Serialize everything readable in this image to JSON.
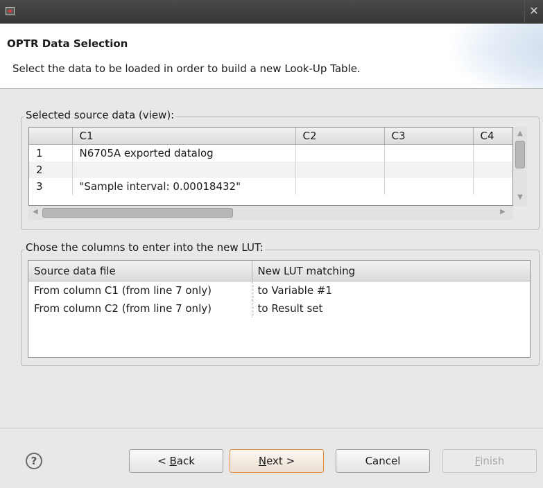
{
  "window": {
    "close_glyph": "✕"
  },
  "header": {
    "title": "OPTR Data Selection",
    "description": "Select the data to be loaded in order to build a new Look-Up Table."
  },
  "source_group": {
    "label": "Selected source data (view):",
    "columns": [
      "",
      "C1",
      "C2",
      "C3",
      "C4"
    ],
    "rows": [
      [
        "1",
        "N6705A exported datalog",
        "",
        "",
        ""
      ],
      [
        "2",
        "",
        "",
        "",
        ""
      ],
      [
        "3",
        "\"Sample interval: 0.00018432\"",
        "",
        "",
        ""
      ]
    ]
  },
  "lut_group": {
    "label": "Chose the columns to enter into the new LUT:",
    "columns": [
      "Source data file",
      "New LUT matching"
    ],
    "rows": [
      [
        "From column C1 (from line 7 only)",
        "to Variable #1"
      ],
      [
        "From column C2 (from line 7 only)",
        "to Result set"
      ]
    ]
  },
  "buttons": {
    "help_glyph": "?",
    "back": {
      "mnemonic": "B",
      "pre": "< ",
      "rest": "ack"
    },
    "next": {
      "mnemonic": "N",
      "rest": "ext >"
    },
    "cancel": "Cancel",
    "finish": {
      "mnemonic": "F",
      "rest": "inish"
    }
  },
  "colors": {
    "primary_border": "#e08a3c",
    "titlebar": "#3c3c3a"
  }
}
